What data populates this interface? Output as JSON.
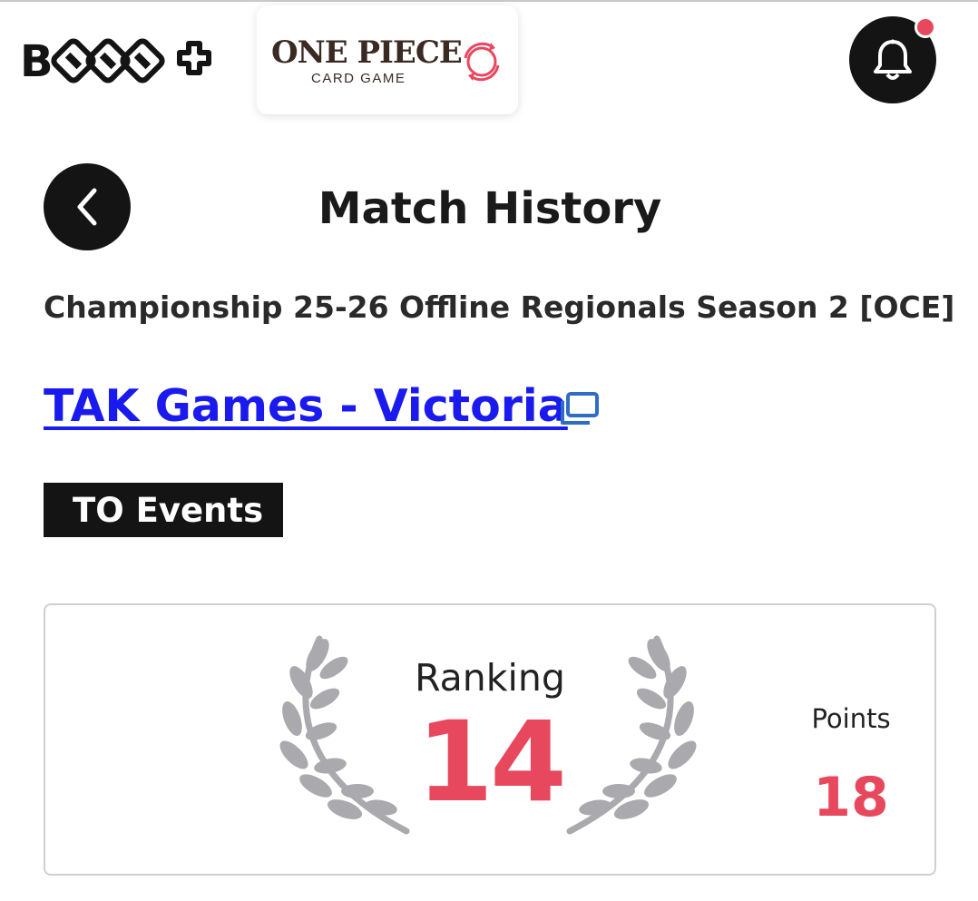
{
  "header": {
    "brand_logo_text": "BTCG+",
    "game_logo": {
      "title": "ONE PIECE",
      "subtitle": "CARD GAME"
    },
    "notification_badge_color": "#e8485e"
  },
  "page": {
    "title": "Match History",
    "event_name": "Championship 25-26 Offline Regionals Season 2 [OCE]",
    "store_link": "TAK Games - Victoria",
    "tag": "TO Events"
  },
  "result": {
    "ranking_label": "Ranking",
    "ranking_value": "14",
    "points_label": "Points",
    "points_value": "18"
  },
  "colors": {
    "accent": "#e8485e",
    "link": "#1a1aee",
    "dark": "#141414",
    "laurel": "#a9a9ae"
  },
  "icons": {
    "back": "chevron-left-icon",
    "notifications": "bell-icon",
    "external_link": "external-link-icon",
    "game_switch": "refresh-icon",
    "laurel": "laurel-wreath-icon"
  }
}
